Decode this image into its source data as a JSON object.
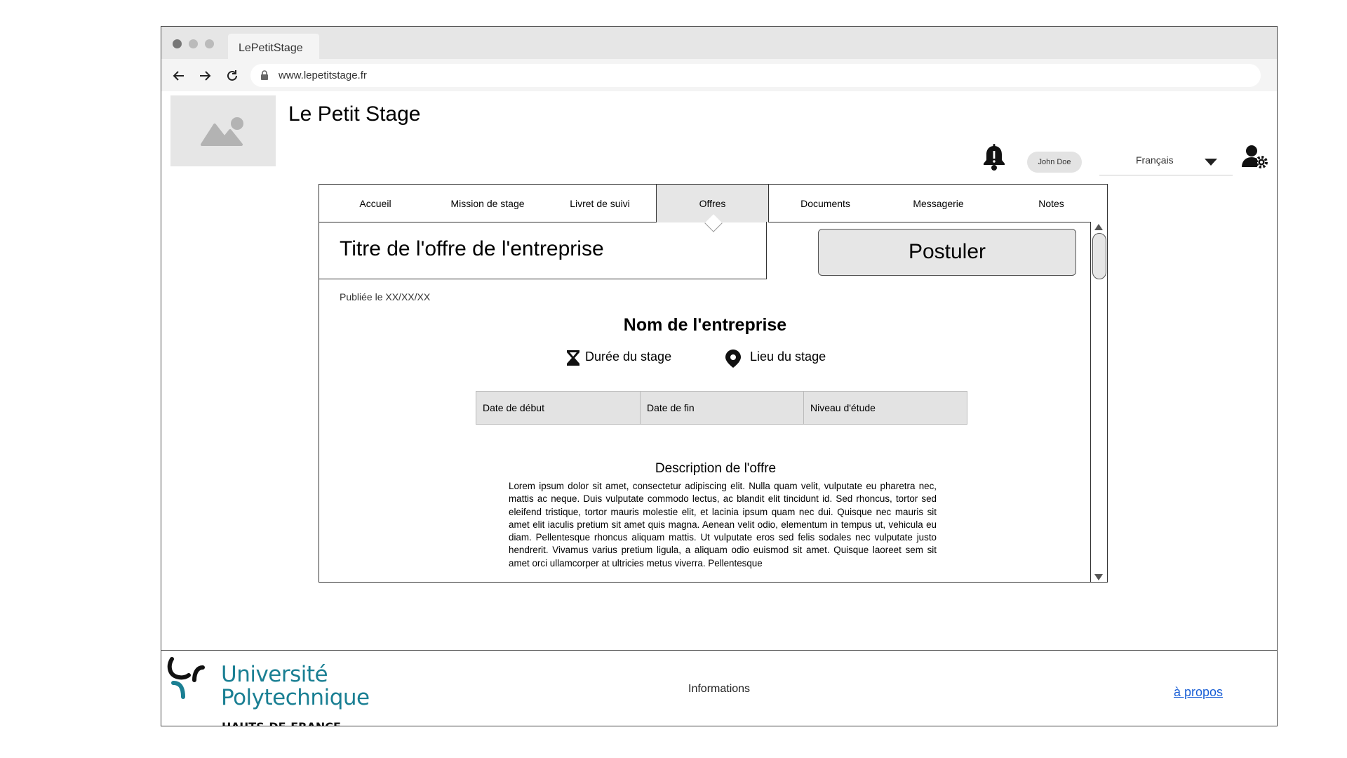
{
  "browser": {
    "tab_title": "LePetitStage",
    "url": "www.lepetitstage.fr"
  },
  "header": {
    "site_title": "Le Petit Stage",
    "user_name": "John Doe",
    "language": "Français"
  },
  "menu": {
    "items": [
      {
        "label": "Accueil"
      },
      {
        "label": "Mission de stage"
      },
      {
        "label": "Livret de suivi"
      },
      {
        "label": "Offres"
      },
      {
        "label": "Documents"
      },
      {
        "label": "Messagerie"
      },
      {
        "label": "Notes"
      }
    ],
    "active": "Offres"
  },
  "offer": {
    "title": "Titre de l'offre de l'entreprise",
    "apply_label": "Postuler",
    "published": "Publiée le XX/XX/XX",
    "company": "Nom de l'entreprise",
    "duration": "Durée du stage",
    "location": "Lieu du stage",
    "table": [
      "Date de début",
      "Date de fin",
      "Niveau d'étude"
    ],
    "description_title": "Description de l'offre",
    "description": "Lorem ipsum dolor sit amet, consectetur adipiscing elit. Nulla quam velit, vulputate eu pharetra nec, mattis ac neque. Duis vulputate commodo lectus, ac blandit elit tincidunt id. Sed rhoncus, tortor sed eleifend tristique, tortor mauris molestie elit, et lacinia ipsum quam nec dui. Quisque nec mauris sit amet elit iaculis pretium sit amet quis magna. Aenean velit odio, elementum in tempus ut, vehicula eu diam. Pellentesque rhoncus aliquam mattis. Ut vulputate eros sed felis sodales nec vulputate justo hendrerit. Vivamus varius pretium ligula, a aliquam odio euismod sit amet. Quisque laoreet sem sit amet orci ullamcorper at ultricies metus viverra. Pellentesque"
  },
  "footer": {
    "logo_line1": "Université",
    "logo_line2": "Polytechnique",
    "logo_line3": "HAUTS-DE-FRANCE",
    "info_label": "Informations",
    "about_label": "à propos"
  },
  "colors": {
    "accent_teal": "#1a7f93",
    "link_blue": "#1a5fd6",
    "panel_gray": "#e6e6e6"
  }
}
